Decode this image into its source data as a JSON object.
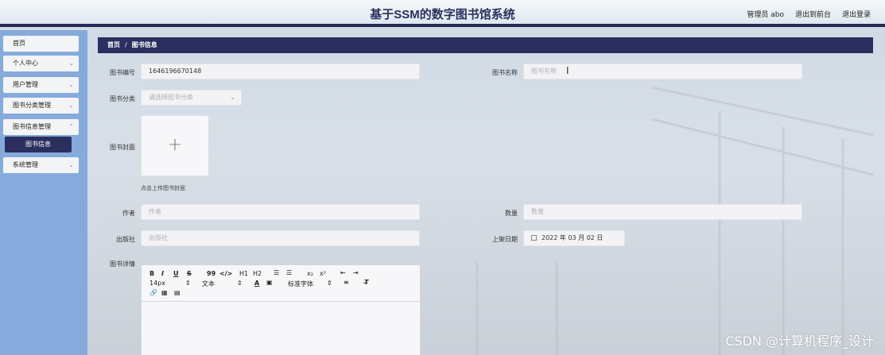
{
  "header": {
    "title": "基于SSM的数字图书馆系统",
    "user_label": "管理员 abo",
    "front_link": "退出到前台",
    "logout_link": "退出登录"
  },
  "sidebar": {
    "items": [
      {
        "label": "首页",
        "has_chevron": false
      },
      {
        "label": "个人中心",
        "has_chevron": true
      },
      {
        "label": "用户管理",
        "has_chevron": true
      },
      {
        "label": "图书分类管理",
        "has_chevron": true
      },
      {
        "label": "图书信息管理",
        "has_chevron": true
      },
      {
        "label": "系统管理",
        "has_chevron": true
      }
    ],
    "active_sub_item": "图书信息",
    "chevron_icon": "chevron-down-icon"
  },
  "breadcrumb": {
    "home": "首页",
    "separator": "/",
    "current": "图书信息"
  },
  "form": {
    "book_no_label": "图书编号",
    "book_no_value": "1646196670148",
    "book_name_label": "图书名称",
    "book_name_placeholder": "图书名称",
    "category_label": "图书分类",
    "category_placeholder": "请选择图书分类",
    "cover_label": "图书封面",
    "cover_hint": "点击上传图书封面",
    "author_label": "作者",
    "author_placeholder": "作者",
    "quantity_label": "数量",
    "quantity_placeholder": "数量",
    "publisher_label": "出版社",
    "publisher_placeholder": "出版社",
    "shelf_date_label": "上架日期",
    "shelf_date_value": "2022 年 03 月 02 日",
    "details_label": "图书详情"
  },
  "editor_toolbar": {
    "bold": "B",
    "italic": "I",
    "underline": "U",
    "strike": "S",
    "quote": "99",
    "code": "</>",
    "h1": "H1",
    "h2": "H2",
    "font_size": "14px",
    "text_type": "文本",
    "font_family": "标准字体"
  },
  "watermark": "CSDN @计算机程序_设计",
  "colors": {
    "primary": "#2b2f5f",
    "sidebar_bg": "#86aadb",
    "header_border": "#252a56"
  }
}
